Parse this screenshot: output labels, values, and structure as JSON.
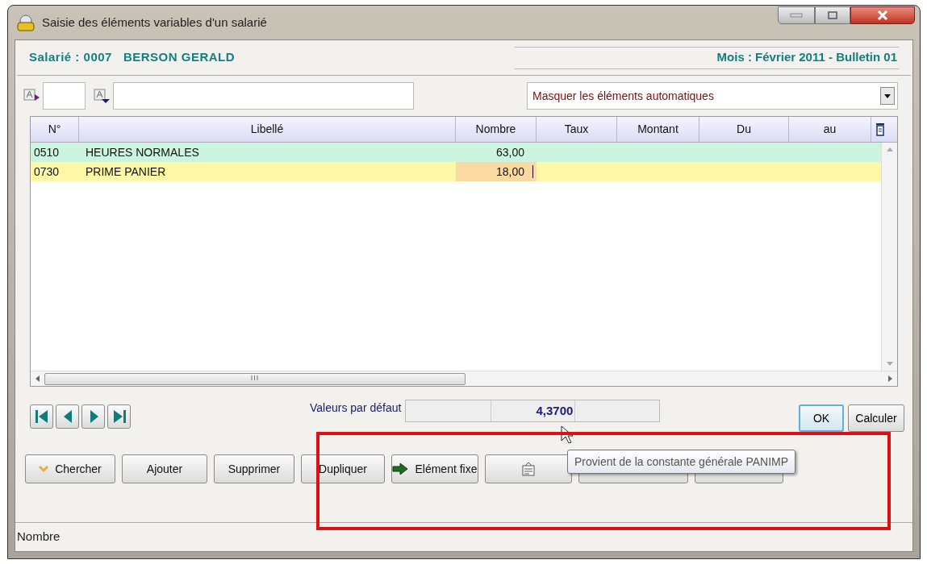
{
  "window": {
    "title": "Saisie des éléments variables d'un salarié"
  },
  "header": {
    "employee": "Salarié : 0007   BERSON GERALD",
    "period": "Mois : Février 2011 - Bulletin 01"
  },
  "filters": {
    "dropdown": "Masquer les éléments automatiques"
  },
  "table": {
    "columns": [
      "N°",
      "Libellé",
      "Nombre",
      "Taux",
      "Montant",
      "Du",
      "au"
    ],
    "rows": [
      {
        "cells": [
          "0510",
          "HEURES NORMALES",
          "63,00",
          "",
          "",
          "",
          ""
        ],
        "color": "#ccf5e0",
        "selected": false
      },
      {
        "cells": [
          "0730",
          "PRIME PANIER",
          "18,00",
          "",
          "",
          "",
          ""
        ],
        "color": "#fcf8a8",
        "selected": true
      }
    ],
    "hscroll_mark": "III"
  },
  "defaults": {
    "label": "Valeurs par défaut",
    "value": "4,3700"
  },
  "buttons_right": [
    "OK",
    "Calculer"
  ],
  "buttons": [
    {
      "kind": "icon-text",
      "label": "Chercher"
    },
    {
      "kind": "text",
      "label": "Ajouter"
    },
    {
      "kind": "text",
      "label": "Supprimer"
    },
    {
      "kind": "text",
      "label": "Dupliquer"
    },
    {
      "kind": "icon-text",
      "label": "Elément fixe"
    },
    {
      "kind": "icon"
    },
    {
      "kind": "blank"
    },
    {
      "kind": "blank"
    }
  ],
  "tooltip": "Provient de la constante générale PANIMP",
  "status_bar": "Nombre"
}
